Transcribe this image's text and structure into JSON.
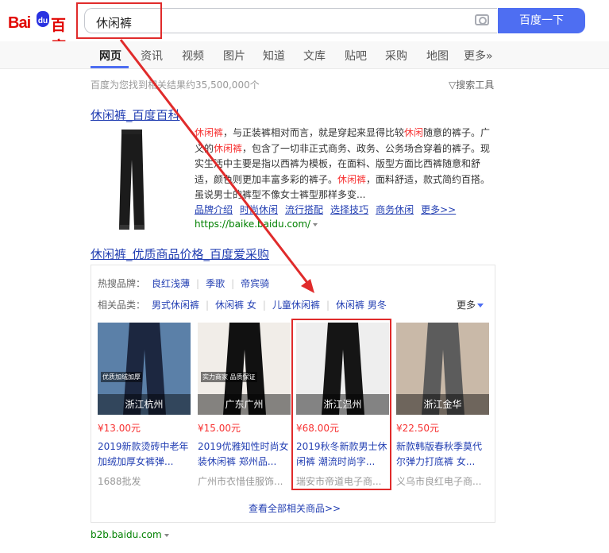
{
  "header": {
    "logo": {
      "bai": "Bai",
      "paw": "du",
      "baidu": "百度"
    },
    "search_value": "休闲裤",
    "search_button": "百度一下"
  },
  "nav": {
    "tabs": [
      "网页",
      "资讯",
      "视频",
      "图片",
      "知道",
      "文库",
      "贴吧",
      "采购",
      "地图",
      "更多»"
    ],
    "active": "网页"
  },
  "results_info": "百度为您找到相关结果约35,500,000个",
  "search_tools": "搜索工具",
  "result1": {
    "title": "休闲裤_百度百科",
    "desc_parts": [
      {
        "t": "休闲裤",
        "hl": true
      },
      {
        "t": "，与正装裤相对而言，就是穿起来显得比较",
        "hl": false
      },
      {
        "t": "休闲",
        "hl": true
      },
      {
        "t": "随意的裤子。广义的",
        "hl": false
      },
      {
        "t": "休闲裤",
        "hl": true
      },
      {
        "t": "，包含了一切非正式商务、政务、公务场合穿着的裤子。现实生活中主要是指以西裤为模板，在面料、版型方面比西裤随意和舒适，颜色则更加丰富多彩的裤子。",
        "hl": false
      },
      {
        "t": "休闲裤",
        "hl": true
      },
      {
        "t": "，面料舒适，款式简约百搭。虽说男士的裤型不像女士裤型那样多变...",
        "hl": false
      }
    ],
    "links": [
      "品牌介绍",
      "时尚休闲",
      "流行搭配",
      "选择技巧",
      "商务休闲",
      "更多>>"
    ],
    "url": "https://baike.baidu.com/"
  },
  "result2": {
    "title": "休闲裤_优质商品价格_百度爱采购",
    "brand_label": "热搜品牌：",
    "brands": [
      "良红浅薄",
      "季歌",
      "帝宾骑"
    ],
    "category_label": "相关品类：",
    "categories": [
      "男式休闲裤",
      "休闲裤 女",
      "儿童休闲裤",
      "休闲裤 男冬"
    ],
    "more": "更多",
    "products": [
      {
        "location": "浙江杭州",
        "price": "¥13.00元",
        "name": "2019新款烫砖中老年加绒加厚女裤弹...",
        "seller": "1688批发",
        "img_text": "优质加绒加厚",
        "bg": "#5b80a8",
        "pant": "#1c2740"
      },
      {
        "location": "广东广州",
        "price": "¥15.00元",
        "name": "2019优雅知性时尚女装休闲裤 郑州品...",
        "seller": "广州市衣惜佳服饰...",
        "img_text": "实力商家 品质保证",
        "bg": "#f1ede8",
        "pant": "#111111"
      },
      {
        "location": "浙江温州",
        "price": "¥68.00元",
        "name": "2019秋冬新款男士休闲裤 潮流时尚字...",
        "seller": "瑞安市帝道电子商...",
        "img_text": "",
        "bg": "#eeeeee",
        "pant": "#151515"
      },
      {
        "location": "浙江金华",
        "price": "¥22.50元",
        "name": "新款韩版春秋季莫代尔弹力打底裤 女...",
        "seller": "义乌市良红电子商...",
        "img_text": "",
        "bg": "#c9b9a8",
        "pant": "#5c5c5c"
      }
    ],
    "view_all": "查看全部相关商品>>",
    "url": "b2b.baidu.com"
  },
  "accent_colors": {
    "brand_blue": "#4e6ef2",
    "highlight_red": "#f73131",
    "annotation_red": "#e02b2b",
    "url_green": "#008000"
  }
}
